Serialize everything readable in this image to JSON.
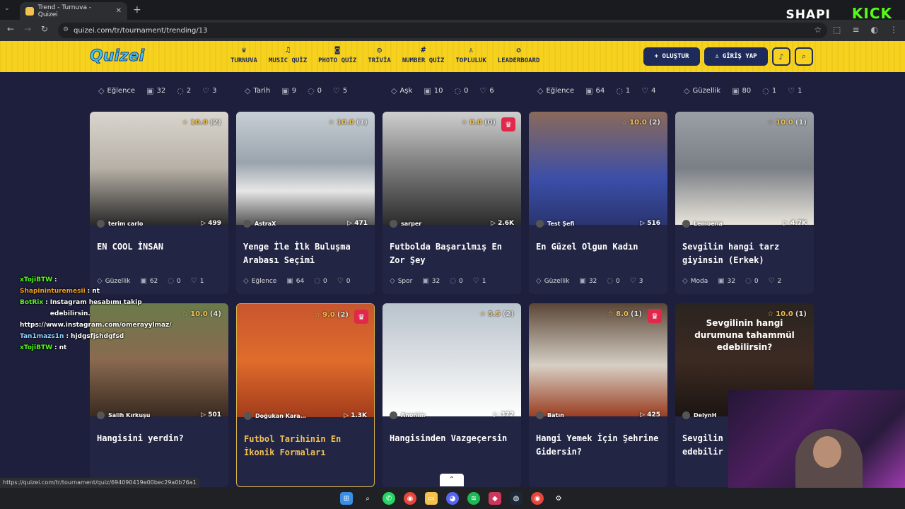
{
  "browser": {
    "tab_title": "Trend - Turnuva - Quizei",
    "url": "quizei.com/tr/tournament/trending/13",
    "status_url": "https://quizei.com/tr/tournament/quiz/694090419e00bec29a0b76a1"
  },
  "stream_overlay": {
    "brand1": "SHAPI",
    "brand2": "KICK"
  },
  "site": {
    "logo": "Quizei",
    "nav": [
      {
        "label": "TURNUVA",
        "icon": "trophy-icon"
      },
      {
        "label": "MUSIC QUİZ",
        "icon": "music-icon"
      },
      {
        "label": "PHOTO QUİZ",
        "icon": "camera-icon"
      },
      {
        "label": "TRİVİA",
        "icon": "chat-icon"
      },
      {
        "label": "NUMBER QUİZ",
        "icon": "hash-icon"
      },
      {
        "label": "TOPLULUK",
        "icon": "users-icon"
      },
      {
        "label": "LEADERBOARD",
        "icon": "medal-icon"
      }
    ],
    "create_label": "+ OLUŞTUR",
    "login_label": "GİRİŞ YAP"
  },
  "top_row_stats": [
    {
      "category": "Eğlence",
      "items": "32",
      "comments": "2",
      "likes": "3"
    },
    {
      "category": "Tarih",
      "items": "9",
      "comments": "0",
      "likes": "5"
    },
    {
      "category": "Aşk",
      "items": "10",
      "comments": "0",
      "likes": "6"
    },
    {
      "category": "Eğlence",
      "items": "64",
      "comments": "1",
      "likes": "4"
    },
    {
      "category": "Güzellik",
      "items": "80",
      "comments": "1",
      "likes": "1"
    }
  ],
  "cards": [
    {
      "rating": "10.0",
      "count": "(2)",
      "author": "terim carlo",
      "plays": "499",
      "title": "EN COOL İNSAN",
      "category": "Güzellik",
      "items": "62",
      "comments": "0",
      "likes": "1",
      "crown": false,
      "gold": false
    },
    {
      "rating": "10.0",
      "count": "(1)",
      "author": "AstraX",
      "plays": "471",
      "title": "Yenge İle İlk Buluşma Arabası Seçimi",
      "category": "Eğlence",
      "items": "64",
      "comments": "0",
      "likes": "0",
      "crown": false,
      "gold": false
    },
    {
      "rating": "0.0",
      "count": "(0)",
      "author": "sarper",
      "plays": "2.6K",
      "title": "Futbolda Başarılmış En Zor Şey",
      "category": "Spor",
      "items": "32",
      "comments": "0",
      "likes": "1",
      "crown": true,
      "gold": false
    },
    {
      "rating": "10.0",
      "count": "(2)",
      "author": "Test Şefi",
      "plays": "516",
      "title": "En Güzel Olgun Kadın",
      "category": "Güzellik",
      "items": "32",
      "comments": "0",
      "likes": "3",
      "crown": false,
      "gold": false
    },
    {
      "rating": "10.0",
      "count": "(1)",
      "author": "Lemoena",
      "plays": "4.7K",
      "title": "Sevgilin hangi tarz giyinsin (Erkek)",
      "category": "Moda",
      "items": "32",
      "comments": "0",
      "likes": "2",
      "crown": false,
      "gold": false
    },
    {
      "rating": "10.0",
      "count": "(4)",
      "author": "Salih Kırkuşu",
      "plays": "501",
      "title": "Hangisini yerdin?",
      "crown": false,
      "gold": false
    },
    {
      "rating": "9.0",
      "count": "(2)",
      "author": "Doğukan Kara…",
      "plays": "1.3K",
      "title": "Futbol Tarihinin En İkonik Formaları",
      "crown": true,
      "gold": true
    },
    {
      "rating": "5.5",
      "count": "(2)",
      "author": "Anonim",
      "plays": "372",
      "title": "Hangisinden Vazgeçersin",
      "crown": false,
      "gold": false
    },
    {
      "rating": "8.0",
      "count": "(1)",
      "author": "Batın",
      "plays": "425",
      "title": "Hangi Yemek İçin Şehrine Gidersin?",
      "crown": true,
      "gold": false
    },
    {
      "rating": "10.0",
      "count": "(1)",
      "author": "DelynH",
      "plays": "",
      "title": "Sevgilin hangi durumuna edebilir",
      "overlay": "Sevgilinin hangi durumuna tahammül edebilirsin?",
      "crown": false,
      "gold": false
    }
  ],
  "chat": [
    {
      "user": "xTojiBTW",
      "msg": "",
      "color": "#53fc18"
    },
    {
      "user": "Shapininturemesii",
      "msg": "nt",
      "color": "#f0a020"
    },
    {
      "user": "BotRix",
      "msg": "Instagram hesabımı takip edebilirsin.",
      "color": "#53fc18"
    },
    {
      "user": "",
      "msg": "https://www.instagram.com/omerayylmaz/",
      "color": "#fff"
    },
    {
      "user": "Tan1mazs1n",
      "msg": "hjdgsfjshdgfsd",
      "color": "#8fd3ff"
    },
    {
      "user": "xTojiBTW",
      "msg": "nt",
      "color": "#53fc18"
    }
  ],
  "colors": {
    "header_bg": "#f6d11e",
    "page_bg": "#1e1f3d",
    "card_bg": "#232544",
    "accent_navy": "#1d2a5a",
    "rating": "#f2c14e",
    "crown": "#e0284a"
  }
}
